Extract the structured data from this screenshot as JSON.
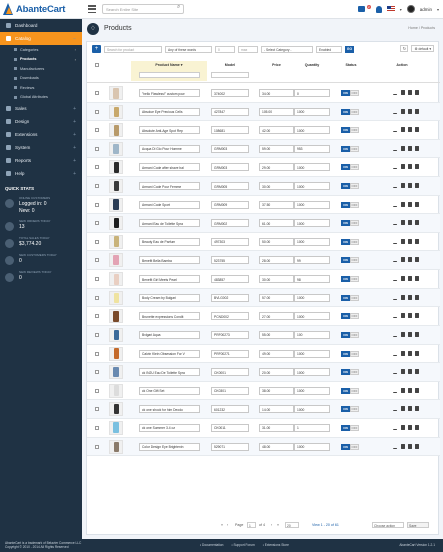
{
  "header": {
    "logo_text": "AbanteCart",
    "search_placeholder": "Search Entire Site",
    "msg_badge": "2",
    "user_name": "admin"
  },
  "sidebar": {
    "items": [
      {
        "label": "Dashboard",
        "icon": "dashboard-icon"
      },
      {
        "label": "Catalog",
        "icon": "tag-icon",
        "active": true
      },
      {
        "label": "Sales",
        "icon": "cart-icon"
      },
      {
        "label": "Design",
        "icon": "palette-icon"
      },
      {
        "label": "Extensions",
        "icon": "puzzle-icon"
      },
      {
        "label": "System",
        "icon": "gear-icon"
      },
      {
        "label": "Reports",
        "icon": "chart-icon"
      },
      {
        "label": "Help",
        "icon": "help-icon"
      }
    ],
    "catalog_sub": [
      {
        "label": "Categories",
        "has_arrow": true
      },
      {
        "label": "Products",
        "active": true,
        "has_arrow": true
      },
      {
        "label": "Manufacturers"
      },
      {
        "label": "Downloads"
      },
      {
        "label": "Reviews"
      },
      {
        "label": "Global Attributes"
      }
    ],
    "quick_stats_title": "QUICK STATS",
    "stats": [
      {
        "label": "ONLINE CUSTOMERS",
        "value1": "Logged in: 0",
        "value2": "New: 0"
      },
      {
        "label": "NEW ORDERS TODAY",
        "value1": "13"
      },
      {
        "label": "TOTAL SALES TODAY",
        "value1": "$3,774.20"
      },
      {
        "label": "NEW CUSTOMERS TODAY",
        "value1": "0"
      },
      {
        "label": "NEW REVIEWS TODAY",
        "value1": "0"
      }
    ]
  },
  "page": {
    "title": "Products",
    "breadcrumb": "Home / Products"
  },
  "toolbar": {
    "search_placeholder": "Search for product",
    "match_select": "Any of these words",
    "price_from": "0",
    "price_to": "max",
    "category_select": "- Select Category -",
    "status_select": "Enabled",
    "go_label": "GO",
    "grid_label": "default"
  },
  "table": {
    "headers": {
      "name": "Product Name",
      "model": "Model",
      "price": "Price",
      "quantity": "Quantity",
      "status": "Status",
      "action": "Action"
    },
    "status_on": "ON",
    "status_off": "OFF",
    "rows": [
      {
        "name": "\"hello Flawless!\" custom pow",
        "model": "374002",
        "price": "34.00",
        "qty": "0",
        "thumb": "#d9c5b0"
      },
      {
        "name": "Absolue Eye Precious Cells",
        "model": "427847",
        "price": "105.00",
        "qty": "1000",
        "thumb": "#c8a86a"
      },
      {
        "name": "Absolute Anti-Age Spot Rep",
        "model": "108681",
        "price": "42.00",
        "qty": "1000",
        "thumb": "#b89a6a"
      },
      {
        "name": "Acqua Di Gio Pour Homme",
        "model": "GRM003",
        "price": "59.00",
        "qty": "953",
        "thumb": "#9fb6c8"
      },
      {
        "name": "Armani Code after shave bal",
        "model": "GRM003",
        "price": "29.00",
        "qty": "1000",
        "thumb": "#2a2a2a"
      },
      {
        "name": "Armani Code Pour Femme",
        "model": "GRM005",
        "price": "30.00",
        "qty": "1000",
        "thumb": "#3a3a3a"
      },
      {
        "name": "Armani Code Sport",
        "model": "GRM009",
        "price": "37.50",
        "qty": "1000",
        "thumb": "#2b3d55"
      },
      {
        "name": "Armani Eau de Toilette Spra",
        "model": "GRM002",
        "price": "61.00",
        "qty": "1000",
        "thumb": "#1e1e1e"
      },
      {
        "name": "Beauty Eau de Parfum",
        "model": "497303",
        "price": "50.00",
        "qty": "1000",
        "thumb": "#c9b37a"
      },
      {
        "name": "Benefit Bella Bamba",
        "model": "523755",
        "price": "28.00",
        "qty": "99",
        "thumb": "#e3a3b4"
      },
      {
        "name": "Benefit Girl Meets Pearl",
        "model": "483857",
        "price": "30.00",
        "qty": "98",
        "thumb": "#e9cfc2"
      },
      {
        "name": "Body Cream by Bulgari",
        "model": "BVLG002",
        "price": "57.00",
        "qty": "1000",
        "thumb": "#efe3a0"
      },
      {
        "name": "Brunette expressions Condit",
        "model": "PCND002",
        "price": "27.00",
        "qty": "1000",
        "thumb": "#7a4a2a"
      },
      {
        "name": "Bvlgari Aqua",
        "model": "PRF00273",
        "price": "55.00",
        "qty": "100",
        "thumb": "#3b6a9a"
      },
      {
        "name": "Calvin Klein Obsession For V",
        "model": "PRF00271",
        "price": "49.00",
        "qty": "1000",
        "thumb": "#c46a2a"
      },
      {
        "name": "ck IN2U Eau De Toilette Spra",
        "model": "CK0001",
        "price": "20.00",
        "qty": "1000",
        "thumb": "#6a8ab0"
      },
      {
        "name": "ck One Gift Set",
        "model": "CK0301",
        "price": "38.00",
        "qty": "1000",
        "thumb": "#dcdcdc"
      },
      {
        "name": "ck one shock for him Deodo",
        "model": "601232",
        "price": "14.00",
        "qty": "1000",
        "thumb": "#333333"
      },
      {
        "name": "ck one Summer 3.4 oz",
        "model": "CK0011",
        "price": "31.00",
        "qty": "1",
        "thumb": "#7ac0e0"
      },
      {
        "name": "Color Design Eye Brightenin",
        "model": "529071",
        "price": "48.00",
        "qty": "1000",
        "thumb": "#8a7a6a"
      }
    ]
  },
  "pager": {
    "page_label": "Page",
    "page_value": "1",
    "of_label": "of 4",
    "per_page": "20",
    "view_label": "View 1 - 20 of 61",
    "choose_action": "Choose action",
    "save_label": "Save"
  },
  "footer": {
    "line1": "AbanteCart is a trademark of Belavier Commerce LLC",
    "line2": "Copyright © 2010 - 2014 All Rights Reserved",
    "doc_link": "Documentation",
    "support_link": "Support Forum",
    "ext_link": "Extensions Store",
    "version": "AbanteCart Version 1.2.1"
  },
  "colors": {
    "sidebar_bg": "#1f3244",
    "accent_orange": "#f7941d",
    "primary_blue": "#1a5fa8"
  }
}
